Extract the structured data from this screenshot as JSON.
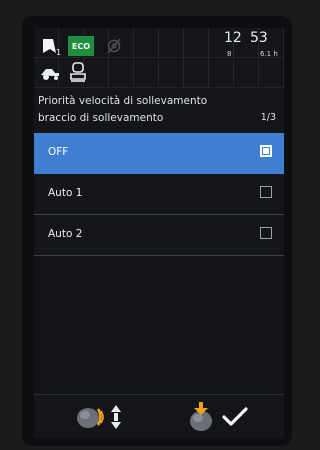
{
  "status": {
    "nav_sub": "1",
    "eco_label": "ECO",
    "time_hour": "12",
    "time_minute": "53",
    "small_left": "8",
    "small_right": "6.1 h"
  },
  "header": {
    "title_line1": "Priorità velocità di sollevamento",
    "title_line2": "braccio di sollevamento",
    "page_indicator": "1/3"
  },
  "options": [
    {
      "label": "OFF",
      "selected": true
    },
    {
      "label": "Auto 1",
      "selected": false
    },
    {
      "label": "Auto 2",
      "selected": false
    }
  ],
  "colors": {
    "accent": "#3f7fd2",
    "eco": "#1d8f3d",
    "knob_bracket": "#f0a41c"
  },
  "icons": {
    "status": [
      "navigation-arrow-icon",
      "gear-disabled-icon",
      "tractor-icon",
      "cabin-icon"
    ],
    "softkeys": [
      "rotary-knob-icon",
      "up-down-arrows-icon",
      "knob-press-icon",
      "checkmark-icon"
    ]
  }
}
